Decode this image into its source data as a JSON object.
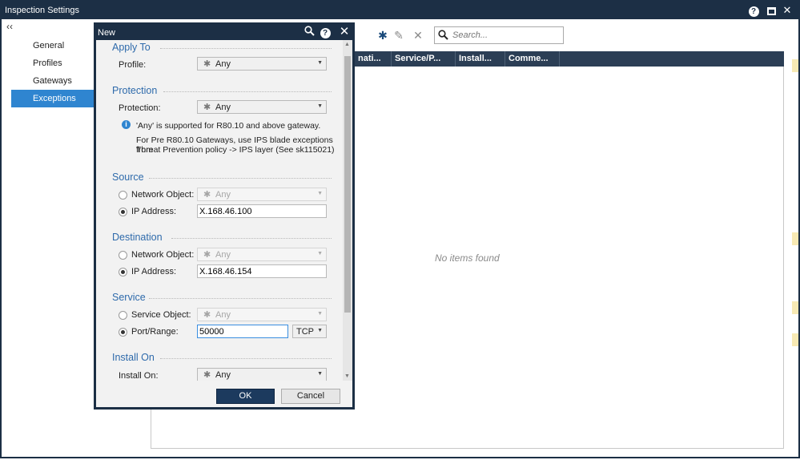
{
  "window": {
    "title": "Inspection Settings"
  },
  "nav": {
    "collapse_glyph": "‹‹",
    "items": [
      {
        "label": "General"
      },
      {
        "label": "Profiles"
      },
      {
        "label": "Gateways"
      },
      {
        "label": "Exceptions",
        "active": true
      }
    ]
  },
  "toolbar": {
    "add_icon": "✱",
    "edit_icon": "✎",
    "delete_icon": "✕",
    "search_placeholder": "Search..."
  },
  "grid": {
    "columns": [
      "...nati...",
      "Service/P...",
      "Install...",
      "Comme..."
    ],
    "column_texts": [
      "nati...",
      "Service/P...",
      "Install...",
      "Comme..."
    ],
    "empty_text": "No items found"
  },
  "dialog": {
    "title": "New",
    "apply_to": {
      "heading": "Apply To",
      "profile_label": "Profile:",
      "profile_value": "Any"
    },
    "protection": {
      "heading": "Protection",
      "protection_label": "Protection:",
      "protection_value": "Any",
      "info_line1": "'Any' is supported for R80.10 and above gateway.",
      "info_line2": "For Pre R80.10 Gateways, use IPS blade exceptions from",
      "info_line3": "Threat Prevention policy -> IPS layer (See sk115021)"
    },
    "source": {
      "heading": "Source",
      "network_object_label": "Network Object:",
      "network_object_value": "Any",
      "ip_label": "IP Address:",
      "ip_value": "X.168.46.100"
    },
    "destination": {
      "heading": "Destination",
      "network_object_label": "Network Object:",
      "network_object_value": "Any",
      "ip_label": "IP Address:",
      "ip_value": "X.168.46.154"
    },
    "service": {
      "heading": "Service",
      "service_object_label": "Service Object:",
      "service_object_value": "Any",
      "port_label": "Port/Range:",
      "port_value": "50000",
      "protocol_value": "TCP"
    },
    "install_on": {
      "heading": "Install On",
      "install_label": "Install On:",
      "install_value": "Any"
    },
    "ok_label": "OK",
    "cancel_label": "Cancel"
  },
  "colors": {
    "titlebar": "#1c2f45",
    "accent": "#2f85d0",
    "section_heading": "#2e6aab"
  }
}
